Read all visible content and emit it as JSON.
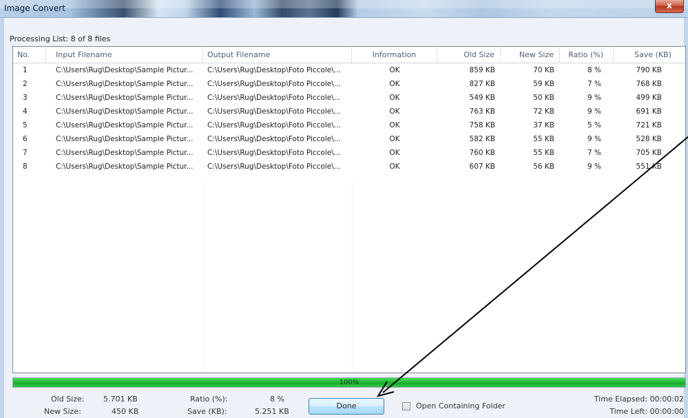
{
  "window": {
    "title": "Image Convert",
    "close_glyph": "x"
  },
  "processing": {
    "caption": "Processing List: 8 of 8 files"
  },
  "table": {
    "columns": [
      "No.",
      "Input Filename",
      "Output Filename",
      "Information",
      "Old Size",
      "New Size",
      "Ratio (%)",
      "Save (KB)"
    ],
    "rows": [
      {
        "no": "1",
        "input": "C:\\Users\\Rug\\Desktop\\Sample Pictur...",
        "output": "C:\\Users\\Rug\\Desktop\\Foto Piccole\\...",
        "info": "OK",
        "old": "859 KB",
        "new": "70 KB",
        "ratio": "8 %",
        "save": "790 KB"
      },
      {
        "no": "2",
        "input": "C:\\Users\\Rug\\Desktop\\Sample Pictur...",
        "output": "C:\\Users\\Rug\\Desktop\\Foto Piccole\\...",
        "info": "OK",
        "old": "827 KB",
        "new": "59 KB",
        "ratio": "7 %",
        "save": "768 KB"
      },
      {
        "no": "3",
        "input": "C:\\Users\\Rug\\Desktop\\Sample Pictur...",
        "output": "C:\\Users\\Rug\\Desktop\\Foto Piccole\\...",
        "info": "OK",
        "old": "549 KB",
        "new": "50 KB",
        "ratio": "9 %",
        "save": "499 KB"
      },
      {
        "no": "4",
        "input": "C:\\Users\\Rug\\Desktop\\Sample Pictur...",
        "output": "C:\\Users\\Rug\\Desktop\\Foto Piccole\\...",
        "info": "OK",
        "old": "763 KB",
        "new": "72 KB",
        "ratio": "9 %",
        "save": "691 KB"
      },
      {
        "no": "5",
        "input": "C:\\Users\\Rug\\Desktop\\Sample Pictur...",
        "output": "C:\\Users\\Rug\\Desktop\\Foto Piccole\\...",
        "info": "OK",
        "old": "758 KB",
        "new": "37 KB",
        "ratio": "5 %",
        "save": "721 KB"
      },
      {
        "no": "6",
        "input": "C:\\Users\\Rug\\Desktop\\Sample Pictur...",
        "output": "C:\\Users\\Rug\\Desktop\\Foto Piccole\\...",
        "info": "OK",
        "old": "582 KB",
        "new": "55 KB",
        "ratio": "9 %",
        "save": "528 KB"
      },
      {
        "no": "7",
        "input": "C:\\Users\\Rug\\Desktop\\Sample Pictur...",
        "output": "C:\\Users\\Rug\\Desktop\\Foto Piccole\\...",
        "info": "OK",
        "old": "760 KB",
        "new": "55 KB",
        "ratio": "7 %",
        "save": "705 KB"
      },
      {
        "no": "8",
        "input": "C:\\Users\\Rug\\Desktop\\Sample Pictur...",
        "output": "C:\\Users\\Rug\\Desktop\\Foto Piccole\\...",
        "info": "OK",
        "old": "607 KB",
        "new": "56 KB",
        "ratio": "9 %",
        "save": "551 KB"
      }
    ]
  },
  "progress": {
    "fraction": 1.0,
    "label": "100%",
    "color": "#1fb933"
  },
  "summary": {
    "old_size_label": "Old Size:",
    "old_size_value": "5.701 KB",
    "new_size_label": "New Size:",
    "new_size_value": "450 KB",
    "ratio_label": "Ratio (%):",
    "ratio_value": "8 %",
    "save_label": "Save (KB):",
    "save_value": "5.251 KB",
    "time_elapsed": "Time Elapsed: 00:00:02",
    "time_left": "Time Left: 00:00:00"
  },
  "actions": {
    "done_label": "Done",
    "open_folder_label": "Open Containing Folder",
    "open_folder_checked": false
  },
  "annotation": {
    "type": "arrow",
    "color": "#000000"
  }
}
